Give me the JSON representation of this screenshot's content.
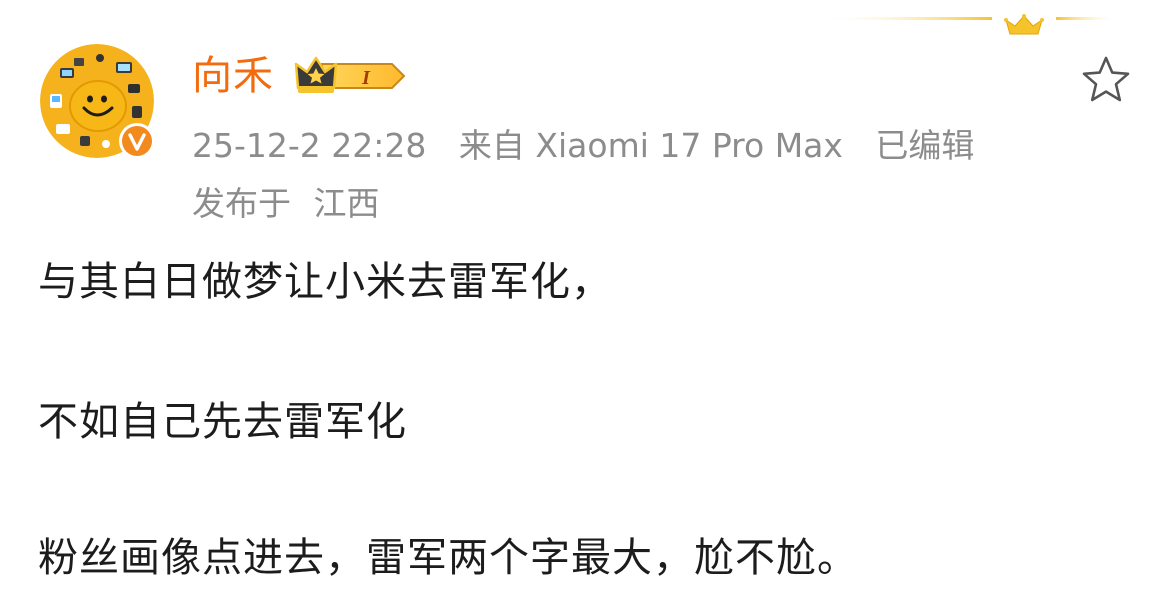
{
  "colors": {
    "username": "#f26b0f",
    "meta_text": "#8c8c8c",
    "body_text": "#1c1c1c",
    "verified_badge": "#f28a1e",
    "avatar_bg": "#f5b21d",
    "crown_gold": "#f5c32c"
  },
  "icons": {
    "avatar": "avatar-yellow-cartoon",
    "verified": "verified-v-badge",
    "vip": "vip-crown-level-badge",
    "favorite": "star-outline-icon",
    "decoration": "gold-crown-icon"
  },
  "author": {
    "name": "向禾",
    "vip_level": "I"
  },
  "meta": {
    "timestamp": "25-12-2 22:28",
    "source": "来自 Xiaomi 17 Pro Max",
    "edited": "已编辑",
    "location_prefix": "发布于",
    "location": "江西"
  },
  "post": {
    "line1": "与其白日做梦让小米去雷军化，",
    "line2": "不如自己先去雷军化",
    "line3": "粉丝画像点进去，雷军两个字最大，尬不尬。"
  }
}
